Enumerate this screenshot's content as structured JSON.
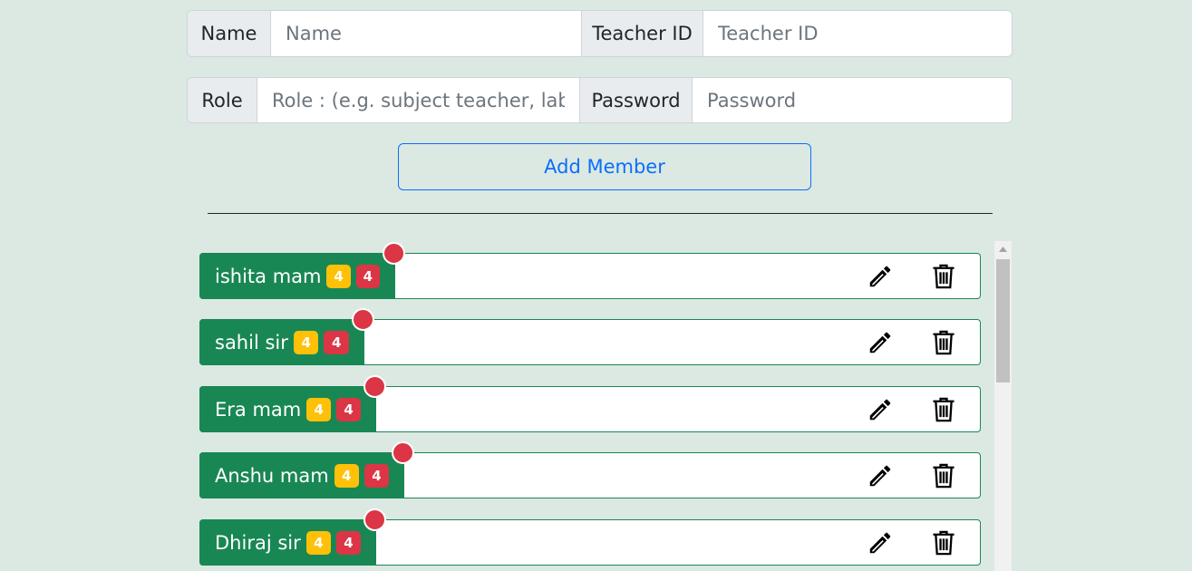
{
  "form": {
    "name_label": "Name",
    "name_placeholder": "Name",
    "teacher_id_label": "Teacher ID",
    "teacher_id_placeholder": "Teacher ID",
    "role_label": "Role",
    "role_placeholder": "Role : (e.g. subject teacher, lab teacher)",
    "password_label": "Password",
    "password_placeholder": "Password",
    "add_button": "Add Member"
  },
  "members": [
    {
      "name": "ishita mam",
      "badge_yellow": "4",
      "badge_red": "4"
    },
    {
      "name": "sahil sir",
      "badge_yellow": "4",
      "badge_red": "4"
    },
    {
      "name": "Era mam",
      "badge_yellow": "4",
      "badge_red": "4"
    },
    {
      "name": "Anshu mam",
      "badge_yellow": "4",
      "badge_red": "4"
    },
    {
      "name": "Dhiraj sir",
      "badge_yellow": "4",
      "badge_red": "4"
    }
  ],
  "icons": {
    "edit": "pencil-icon",
    "delete": "trash-icon",
    "notification": "red-dot"
  },
  "colors": {
    "background": "#dbe9e2",
    "primary": "#0d6efd",
    "success": "#198754",
    "warning": "#ffc107",
    "danger": "#dc3545"
  }
}
